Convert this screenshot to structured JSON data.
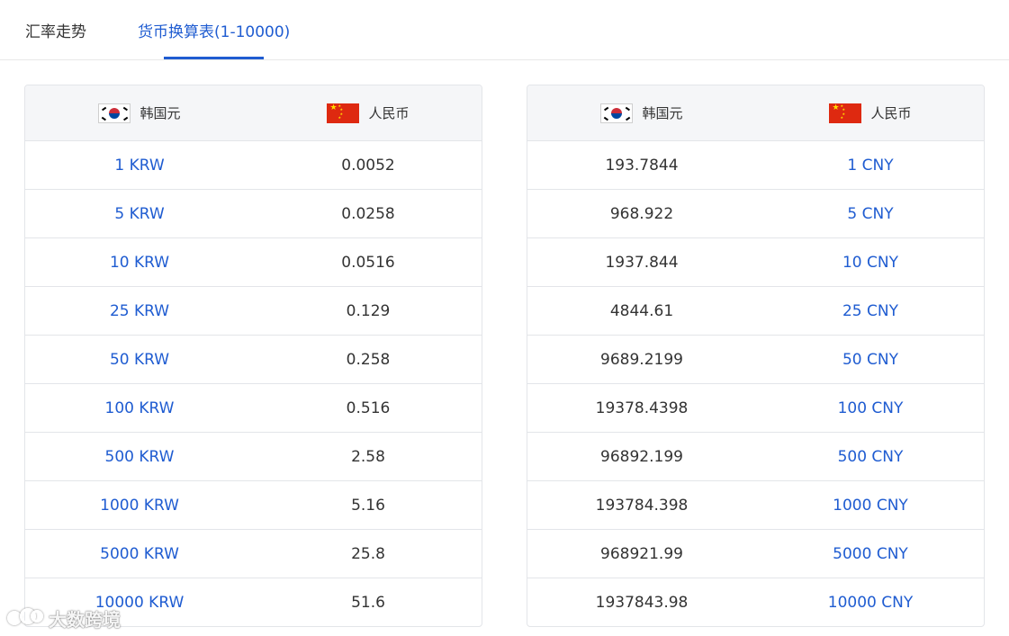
{
  "tabs": {
    "trend_label": "汇率走势",
    "table_label": "货币换算表(1-10000)"
  },
  "left_table": {
    "header": {
      "from": "韩国元",
      "to": "人民币"
    },
    "rows": [
      {
        "amount": "1 KRW",
        "value": "0.0052"
      },
      {
        "amount": "5 KRW",
        "value": "0.0258"
      },
      {
        "amount": "10 KRW",
        "value": "0.0516"
      },
      {
        "amount": "25 KRW",
        "value": "0.129"
      },
      {
        "amount": "50 KRW",
        "value": "0.258"
      },
      {
        "amount": "100 KRW",
        "value": "0.516"
      },
      {
        "amount": "500 KRW",
        "value": "2.58"
      },
      {
        "amount": "1000 KRW",
        "value": "5.16"
      },
      {
        "amount": "5000 KRW",
        "value": "25.8"
      },
      {
        "amount": "10000 KRW",
        "value": "51.6"
      }
    ]
  },
  "right_table": {
    "header": {
      "from": "韩国元",
      "to": "人民币"
    },
    "rows": [
      {
        "value": "193.7844",
        "amount": "1 CNY"
      },
      {
        "value": "968.922",
        "amount": "5 CNY"
      },
      {
        "value": "1937.844",
        "amount": "10 CNY"
      },
      {
        "value": "4844.61",
        "amount": "25 CNY"
      },
      {
        "value": "9689.2199",
        "amount": "50 CNY"
      },
      {
        "value": "19378.4398",
        "amount": "100 CNY"
      },
      {
        "value": "96892.199",
        "amount": "500 CNY"
      },
      {
        "value": "193784.398",
        "amount": "1000 CNY"
      },
      {
        "value": "968921.99",
        "amount": "5000 CNY"
      },
      {
        "value": "1937843.98",
        "amount": "10000 CNY"
      }
    ]
  },
  "watermark": {
    "text": "大数跨境"
  },
  "colors": {
    "accent": "#1f5cd1",
    "text": "#333333",
    "header_bg": "#f5f6f8",
    "border": "#e3e5e9"
  },
  "icons": {
    "krw_flag": "south-korea-flag-icon",
    "cny_flag": "china-flag-icon",
    "watermark_logo": "brand-logo-icon"
  }
}
